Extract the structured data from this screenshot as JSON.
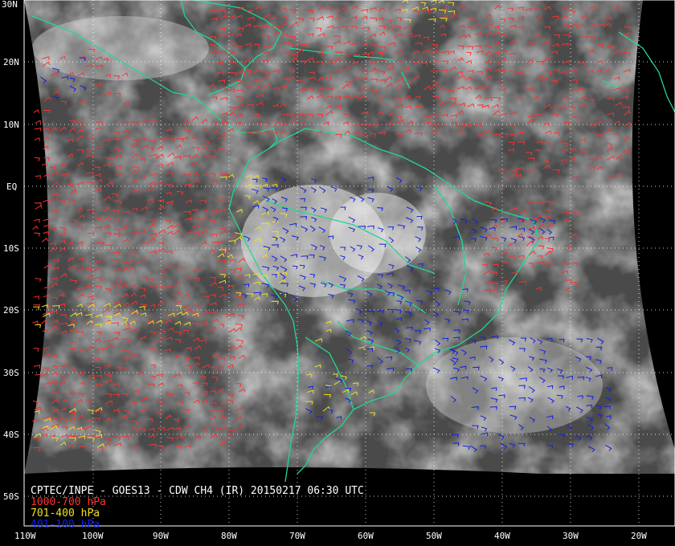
{
  "product": {
    "title": "CPTEC/INPE - GOES13 - CDW CH4 (IR) 20150217 06:30 UTC"
  },
  "legend": [
    {
      "label": "1000-700 hPa",
      "color": "#ff3030"
    },
    {
      "label": "701-400 hPa",
      "color": "#f0e020"
    },
    {
      "label": "401-100 hPa",
      "color": "#1020e0"
    }
  ],
  "lat_labels": [
    "30N",
    "20N",
    "10N",
    "EQ",
    "10S",
    "20S",
    "30S",
    "40S",
    "50S"
  ],
  "lon_labels": [
    "110W",
    "100W",
    "90W",
    "80W",
    "70W",
    "60W",
    "50W",
    "40W",
    "30W",
    "20W"
  ],
  "colors": {
    "background": "#000000",
    "coast": "#20d890",
    "grid": "#ffffff",
    "frame": "#ffffff"
  }
}
